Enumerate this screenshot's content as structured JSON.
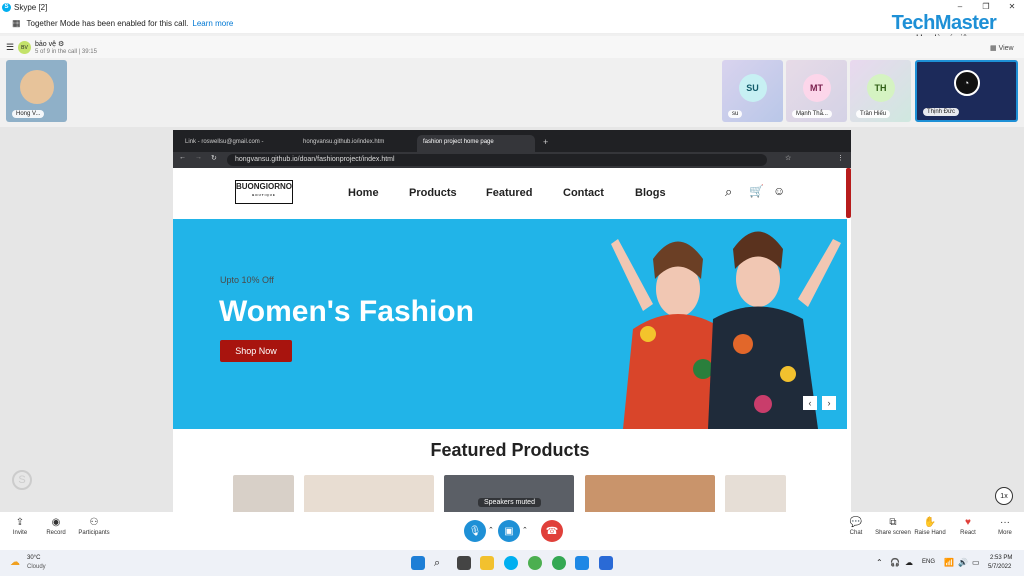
{
  "window": {
    "title": "Skype [2]",
    "min": "–",
    "max": "❐",
    "close": "✕"
  },
  "notice": {
    "text": "Together Mode has been enabled for this call.",
    "link": "Learn more"
  },
  "brand": {
    "name": "TechMaster",
    "slogan": "Học là có việc"
  },
  "call": {
    "avatar": "BV",
    "name": "bảo vệ ⚙",
    "status": "5 of 9 in the call | 39:15",
    "view": "View"
  },
  "participants": [
    {
      "label": "Hong V..."
    },
    {
      "initials": "SU",
      "label": "su"
    },
    {
      "initials": "MT",
      "label": "Mạnh Thắ..."
    },
    {
      "initials": "TH",
      "label": "Trần Hiếu"
    },
    {
      "label": "Thịnh Đức"
    }
  ],
  "browser": {
    "tabs": [
      "Link - roswellsu@gmail.com -",
      "hongvansu.github.io/index.htm",
      "fashion project home page",
      "+"
    ],
    "url": "hongvansu.github.io/doan/fashionproject/index.html"
  },
  "site": {
    "logo": "BUONGIORNO",
    "logo_sub": "BOUTIQUE",
    "nav": [
      "Home",
      "Products",
      "Featured",
      "Contact",
      "Blogs"
    ],
    "hero_kicker": "Upto 10% Off",
    "hero_title": "Women's Fashion",
    "shop_button": "Shop Now",
    "prev": "‹",
    "next": "›",
    "featured_title": "Featured Products"
  },
  "overlay": {
    "muted": "Speakers muted",
    "zoom": "1x"
  },
  "controls": {
    "left": [
      "Invite",
      "Record",
      "Participants"
    ],
    "right": [
      "Chat",
      "Share screen",
      "Raise Hand",
      "React",
      "More"
    ]
  },
  "taskbar": {
    "temp": "30°C",
    "weather": "Cloudy",
    "lang": "ENG",
    "time": "2:53 PM",
    "date": "5/7/2022"
  }
}
